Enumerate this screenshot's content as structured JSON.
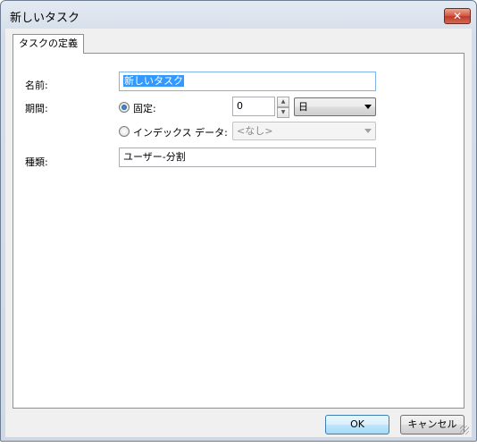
{
  "window": {
    "title": "新しいタスク",
    "close_label": "✕"
  },
  "tabs": [
    {
      "label": "タスクの定義",
      "active": true
    }
  ],
  "form": {
    "name": {
      "label": "名前:",
      "value": "新しいタスク"
    },
    "period": {
      "label": "期間:",
      "fixed": {
        "label": "固定:",
        "checked": true,
        "value": "0",
        "unit_selected": "日"
      },
      "index": {
        "label": "インデックス データ:",
        "checked": false,
        "selected": "<なし>"
      }
    },
    "type": {
      "label": "種類:",
      "value": "ユーザー-分割"
    }
  },
  "buttons": {
    "ok": "OK",
    "cancel": "キャンセル"
  }
}
